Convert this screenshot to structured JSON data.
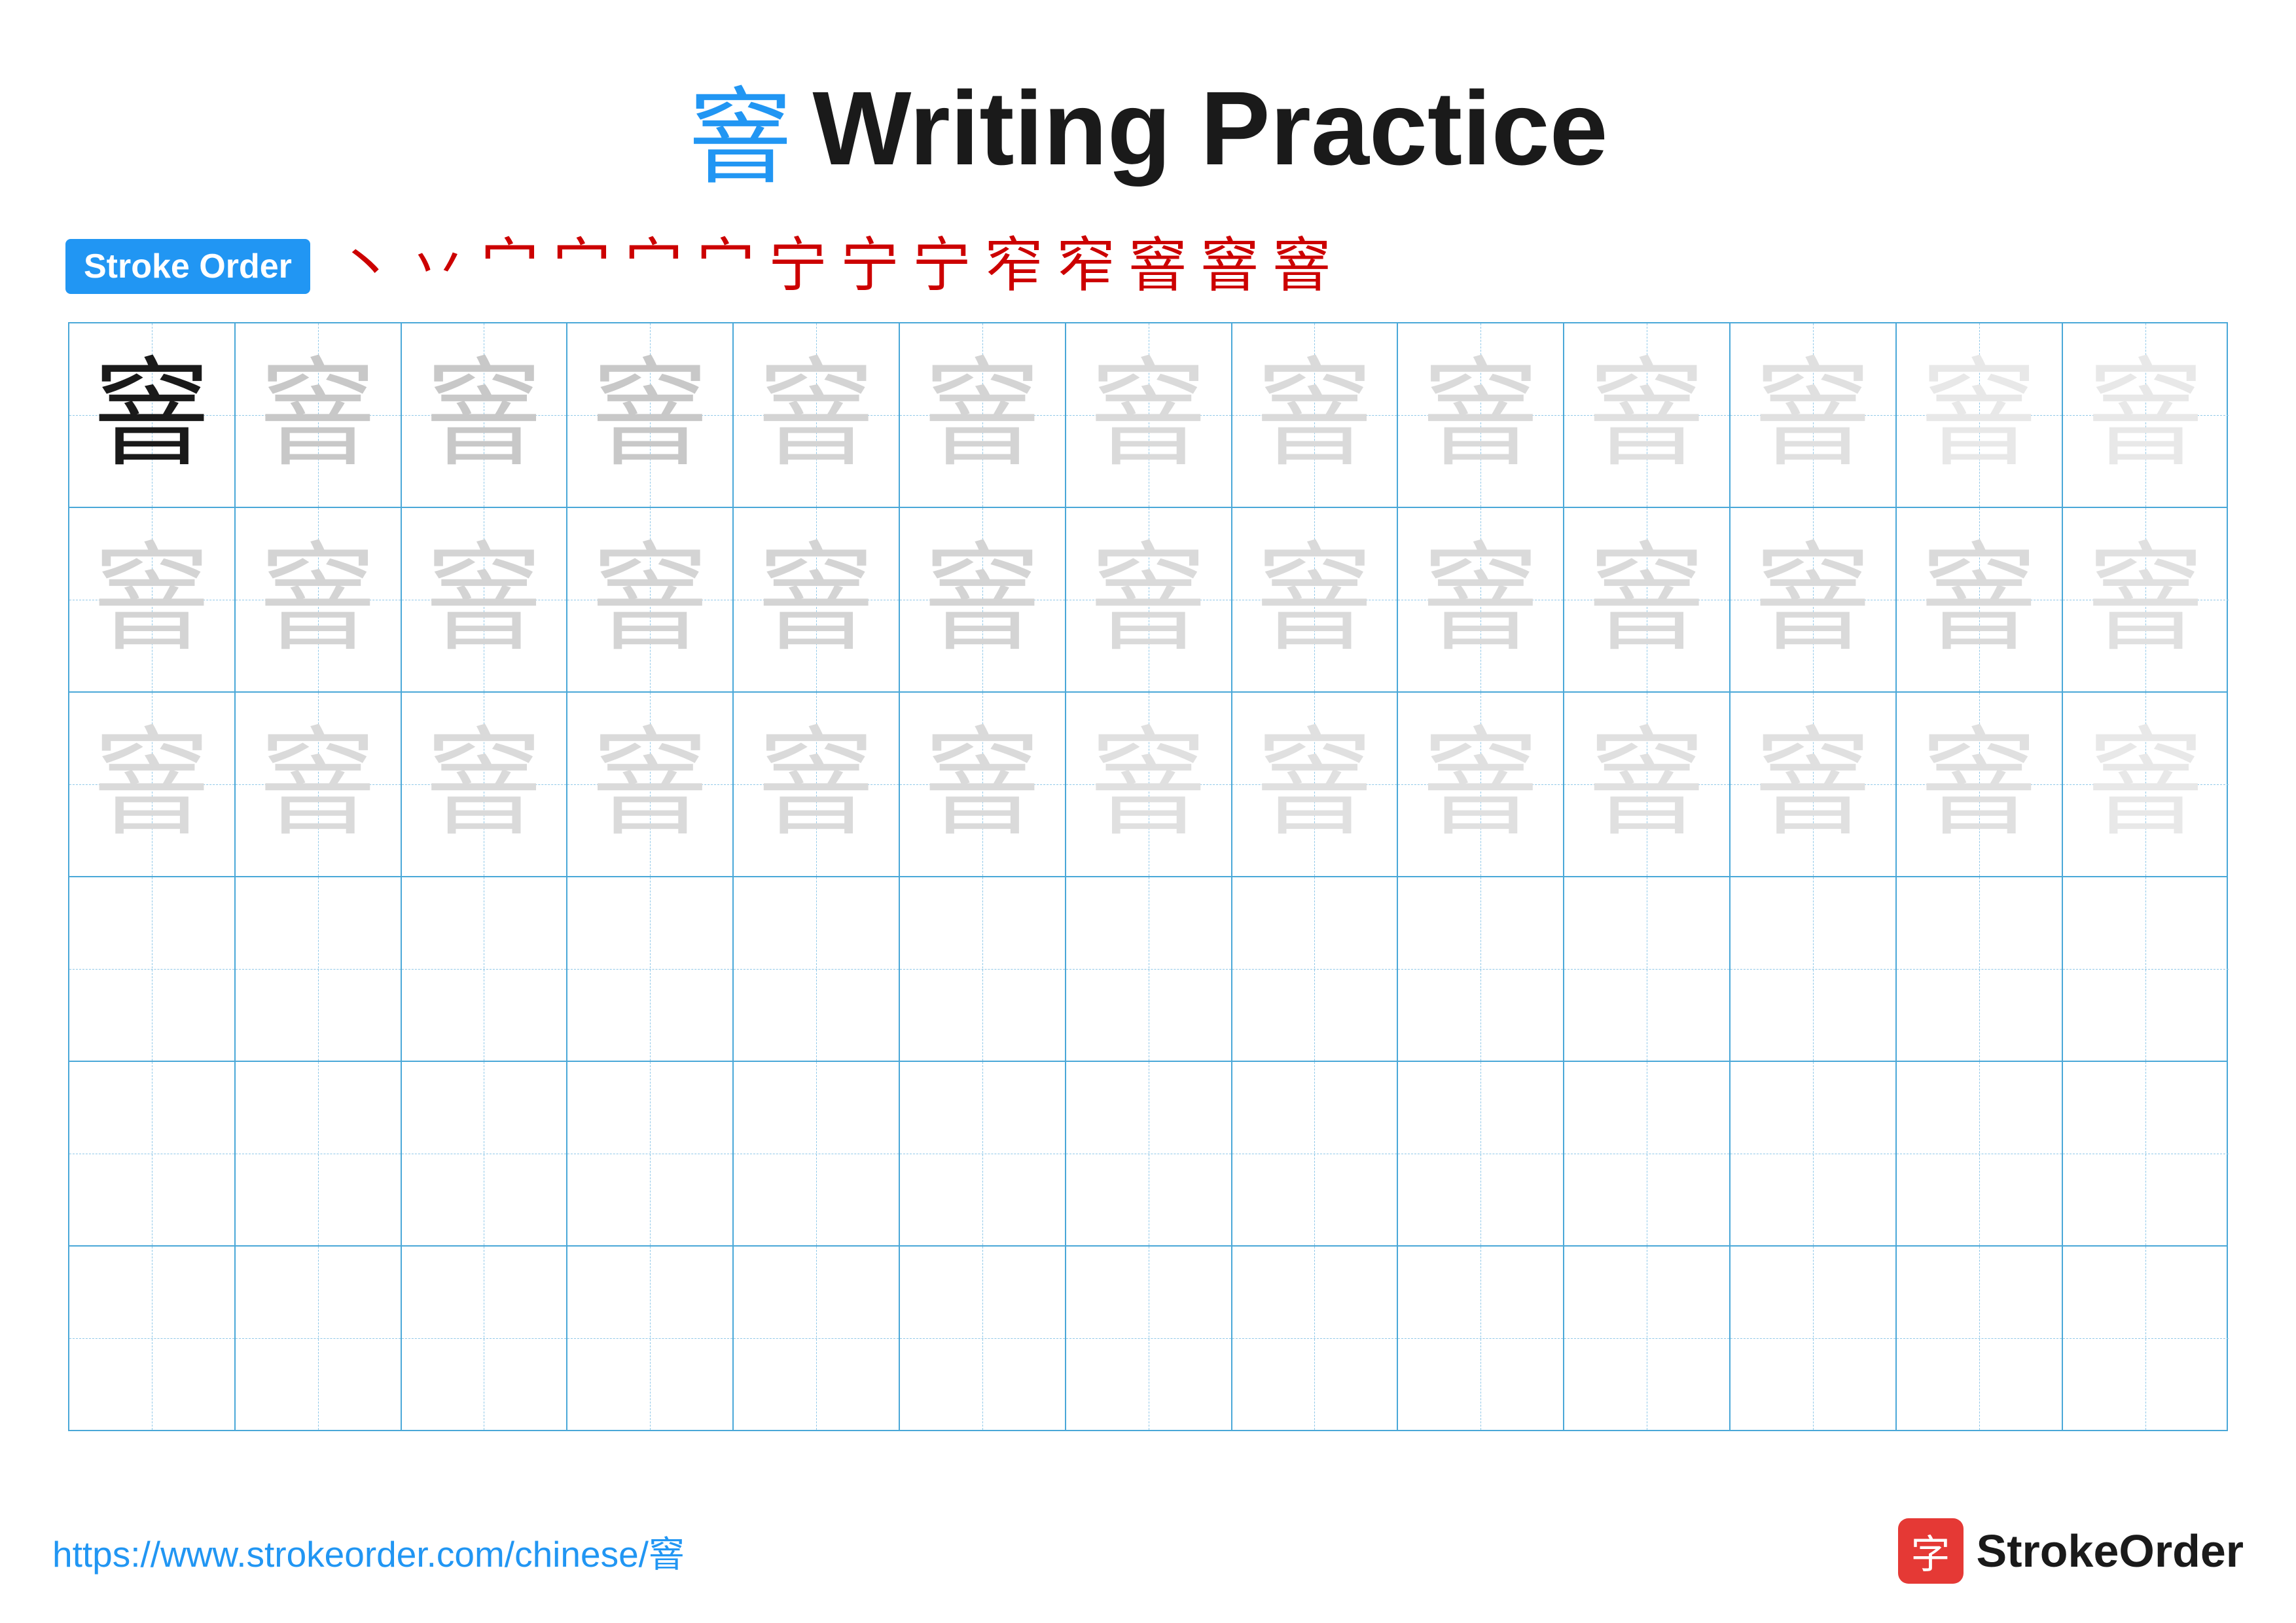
{
  "title": {
    "char": "窨",
    "text": "Writing Practice"
  },
  "stroke_order": {
    "badge_label": "Stroke Order",
    "steps": [
      "丶",
      "丷",
      "宀",
      "宀",
      "宀",
      "宀",
      "宁",
      "宁",
      "宁",
      "窄",
      "窄",
      "窨",
      "窨",
      "窨"
    ]
  },
  "character": "窨",
  "grid": {
    "rows": 6,
    "cols": 13
  },
  "footer": {
    "url": "https://www.strokeorder.com/chinese/窨",
    "logo_text": "StrokeOrder",
    "logo_char": "字"
  }
}
